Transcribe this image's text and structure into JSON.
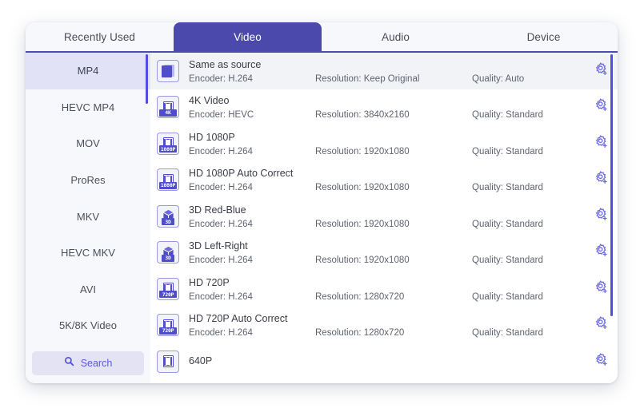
{
  "window": {
    "accent_color": "#4b4aac",
    "scrollbar_color": "#4f4ee0",
    "selected_row_color": "#f2f3f7"
  },
  "tabs": [
    {
      "label": "Recently Used",
      "active": false
    },
    {
      "label": "Video",
      "active": true
    },
    {
      "label": "Audio",
      "active": false
    },
    {
      "label": "Device",
      "active": false
    }
  ],
  "sidebar": {
    "items": [
      {
        "label": "MP4",
        "active": true
      },
      {
        "label": "HEVC MP4",
        "active": false
      },
      {
        "label": "MOV",
        "active": false
      },
      {
        "label": "ProRes",
        "active": false
      },
      {
        "label": "MKV",
        "active": false
      },
      {
        "label": "HEVC MKV",
        "active": false
      },
      {
        "label": "AVI",
        "active": false
      },
      {
        "label": "5K/8K Video",
        "active": false
      }
    ],
    "search": {
      "label": "Search",
      "icon": "search-icon"
    },
    "scrollbar": "sidebar-scrollbar"
  },
  "presets": [
    {
      "title": "Same as source",
      "encoder": "Encoder: H.264",
      "resolution": "Resolution: Keep Original",
      "quality": "Quality: Auto",
      "icon": "same-as-source-icon",
      "badge": "",
      "selected": true
    },
    {
      "title": "4K Video",
      "encoder": "Encoder: HEVC",
      "resolution": "Resolution: 3840x2160",
      "quality": "Quality: Standard",
      "icon": "film-icon",
      "badge": "4K",
      "selected": false
    },
    {
      "title": "HD 1080P",
      "encoder": "Encoder: H.264",
      "resolution": "Resolution: 1920x1080",
      "quality": "Quality: Standard",
      "icon": "film-icon",
      "badge": "1080P",
      "selected": false
    },
    {
      "title": "HD 1080P Auto Correct",
      "encoder": "Encoder: H.264",
      "resolution": "Resolution: 1920x1080",
      "quality": "Quality: Standard",
      "icon": "film-icon",
      "badge": "1080P",
      "selected": false
    },
    {
      "title": "3D Red-Blue",
      "encoder": "Encoder: H.264",
      "resolution": "Resolution: 1920x1080",
      "quality": "Quality: Standard",
      "icon": "cube-icon",
      "badge": "3D",
      "selected": false
    },
    {
      "title": "3D Left-Right",
      "encoder": "Encoder: H.264",
      "resolution": "Resolution: 1920x1080",
      "quality": "Quality: Standard",
      "icon": "cube-icon",
      "badge": "3D",
      "selected": false
    },
    {
      "title": "HD 720P",
      "encoder": "Encoder: H.264",
      "resolution": "Resolution: 1280x720",
      "quality": "Quality: Standard",
      "icon": "film-icon",
      "badge": "720P",
      "selected": false
    },
    {
      "title": "HD 720P Auto Correct",
      "encoder": "Encoder: H.264",
      "resolution": "Resolution: 1280x720",
      "quality": "Quality: Standard",
      "icon": "film-icon",
      "badge": "720P",
      "selected": false
    },
    {
      "title": "640P",
      "encoder": "",
      "resolution": "",
      "quality": "",
      "icon": "film-icon",
      "badge": "",
      "selected": false
    }
  ],
  "gear_icon": "settings-add-icon"
}
